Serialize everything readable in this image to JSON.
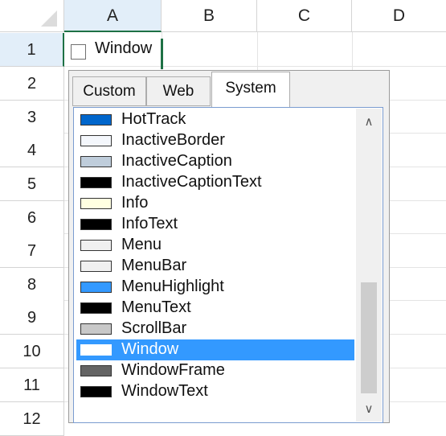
{
  "columns": [
    "A",
    "B",
    "C",
    "D"
  ],
  "rows": [
    "1",
    "2",
    "3",
    "4",
    "5",
    "6",
    "7",
    "8",
    "9",
    "10",
    "11",
    "12"
  ],
  "cell_a1": {
    "text": "Window"
  },
  "tabs": [
    "Custom",
    "Web",
    "System"
  ],
  "active_tab": "System",
  "colors": [
    {
      "name": "HotTrack",
      "hex": "#0066cc"
    },
    {
      "name": "InactiveBorder",
      "hex": "#f4f7fc"
    },
    {
      "name": "InactiveCaption",
      "hex": "#bfcddb"
    },
    {
      "name": "InactiveCaptionText",
      "hex": "#000000"
    },
    {
      "name": "Info",
      "hex": "#ffffe1"
    },
    {
      "name": "InfoText",
      "hex": "#000000"
    },
    {
      "name": "Menu",
      "hex": "#f0f0f0"
    },
    {
      "name": "MenuBar",
      "hex": "#f0f0f0"
    },
    {
      "name": "MenuHighlight",
      "hex": "#3399ff"
    },
    {
      "name": "MenuText",
      "hex": "#000000"
    },
    {
      "name": "ScrollBar",
      "hex": "#c8c8c8"
    },
    {
      "name": "Window",
      "hex": "#ffffff"
    },
    {
      "name": "WindowFrame",
      "hex": "#646464"
    },
    {
      "name": "WindowText",
      "hex": "#000000"
    }
  ],
  "selected_color": "Window",
  "accent": "#1e7145",
  "selection_color": "#3399ff"
}
